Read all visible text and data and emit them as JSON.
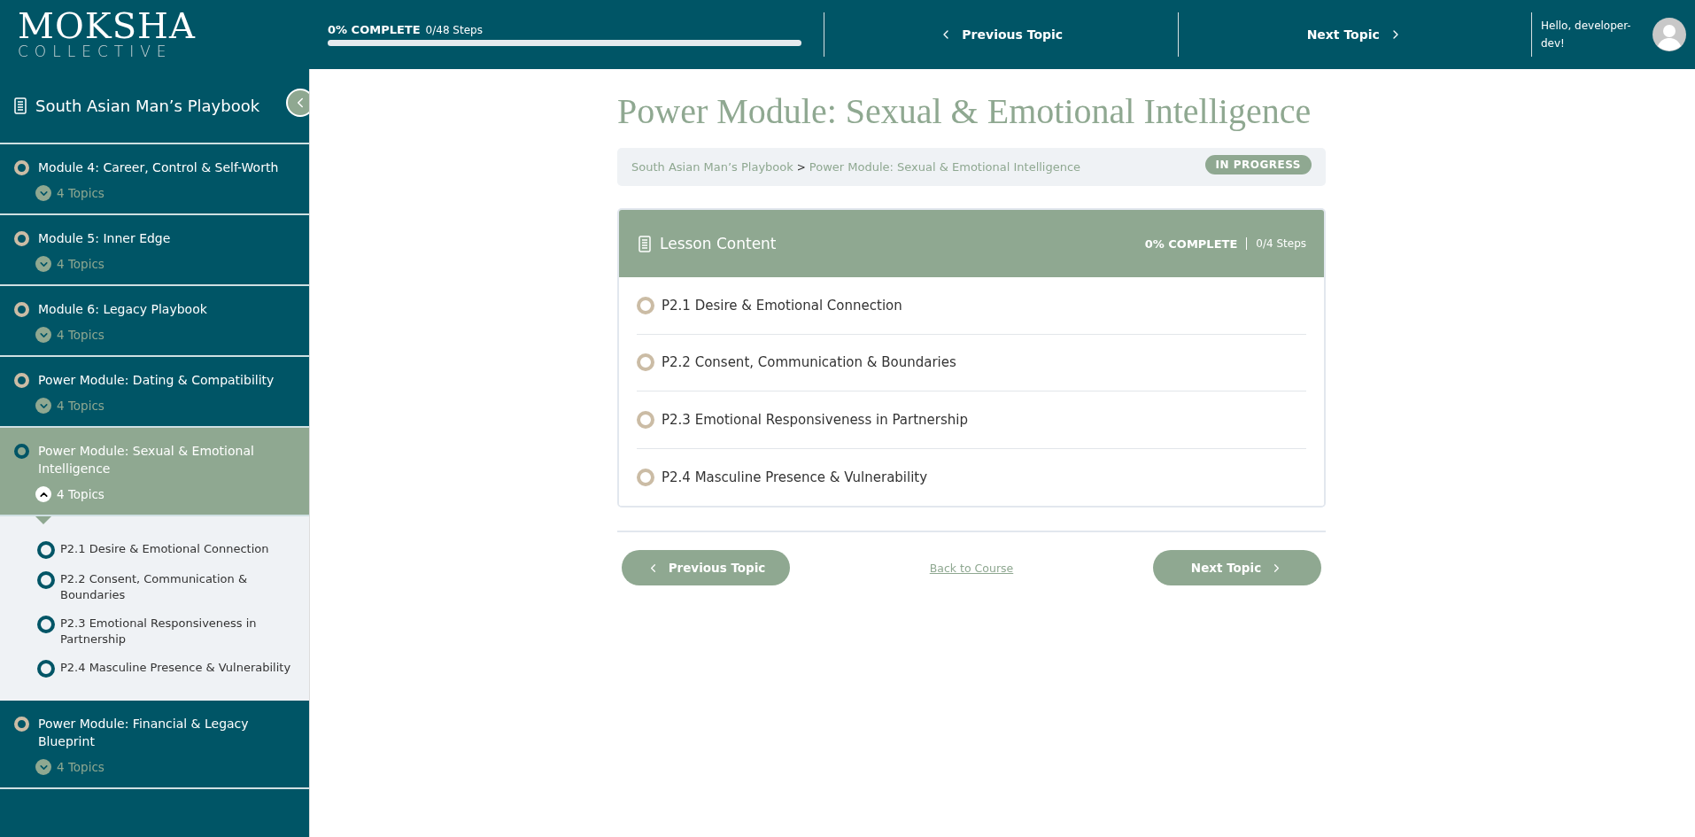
{
  "header": {
    "logo": {
      "top": "MOKSHA",
      "bottom": "COLLECTIVE"
    },
    "progress": {
      "percent": "0% COMPLETE",
      "steps": "0/48 Steps",
      "level": 0
    },
    "previous": "Previous Topic",
    "next": "Next Topic",
    "greeting": "Hello, developer-dev!"
  },
  "sidebar": {
    "course_title": "South Asian Man’s Playbook",
    "modules": [
      {
        "title": "Module 4: Career, Control & Self-Worth",
        "topics_label": "4 Topics",
        "selected": false,
        "expanded": false
      },
      {
        "title": "Module 5: Inner Edge",
        "topics_label": "4 Topics",
        "selected": false,
        "expanded": false
      },
      {
        "title": "Module 6: Legacy Playbook",
        "topics_label": "4 Topics",
        "selected": false,
        "expanded": false
      },
      {
        "title": "Power Module: Dating & Compatibility",
        "topics_label": "4 Topics",
        "selected": false,
        "expanded": false
      },
      {
        "title": "Power Module: Sexual & Emotional Intelligence",
        "topics_label": "4 Topics",
        "selected": true,
        "expanded": true,
        "topics": [
          "P2.1 Desire & Emotional Connection",
          "P2.2 Consent, Communication & Boundaries",
          "P2.3 Emotional Responsiveness in Partnership",
          "P2.4 Masculine Presence & Vulnerability"
        ]
      },
      {
        "title": "Power Module: Financial & Legacy Blueprint",
        "topics_label": "4 Topics",
        "selected": false,
        "expanded": false
      }
    ]
  },
  "main": {
    "title": "Power Module: Sexual & Emotional Intelligence",
    "breadcrumb": [
      "South Asian Man’s Playbook",
      "Power Module: Sexual & Emotional Intelligence"
    ],
    "breadcrumb_separator": ">",
    "status": "IN PROGRESS",
    "lesson_content": {
      "heading": "Lesson Content",
      "percent": "0% COMPLETE",
      "steps": "0/4 Steps",
      "topics": [
        "P2.1 Desire & Emotional Connection",
        "P2.2 Consent, Communication & Boundaries",
        "P2.3 Emotional Responsiveness in Partnership",
        "P2.4 Masculine Presence & Vulnerability"
      ]
    },
    "previous": "Previous Topic",
    "back": "Back to Course",
    "next": "Next Topic"
  }
}
